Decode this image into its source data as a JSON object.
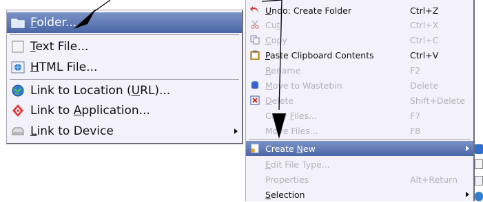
{
  "left_menu": {
    "items": [
      {
        "label_pre": "",
        "accel": "F",
        "label_post": "older..."
      },
      {
        "label_pre": "",
        "accel": "T",
        "label_post": "ext File..."
      },
      {
        "label_pre": "",
        "accel": "H",
        "label_post": "TML File..."
      },
      {
        "label_pre": "Link to Location (",
        "accel": "U",
        "label_post": "RL)..."
      },
      {
        "label_pre": "Link to ",
        "accel": "A",
        "label_post": "pplication..."
      },
      {
        "label_pre": "",
        "accel": "L",
        "label_post": "ink to Device"
      }
    ]
  },
  "right_menu": {
    "items": [
      {
        "label_pre": "",
        "accel": "U",
        "label_post": "ndo: Create Folder",
        "shortcut": "Ctrl+Z"
      },
      {
        "label_pre": "Cu",
        "accel": "t",
        "label_post": "",
        "shortcut": "Ctrl+X"
      },
      {
        "label_pre": "",
        "accel": "C",
        "label_post": "opy",
        "shortcut": "Ctrl+C"
      },
      {
        "label_pre": "",
        "accel": "P",
        "label_post": "aste Clipboard Contents",
        "shortcut": "Ctrl+V"
      },
      {
        "label_pre": "",
        "accel": "R",
        "label_post": "ename",
        "shortcut": "F2"
      },
      {
        "label_pre": "",
        "accel": "M",
        "label_post": "ove to Wastebin",
        "shortcut": "Delete"
      },
      {
        "label_pre": "",
        "accel": "D",
        "label_post": "elete",
        "shortcut": "Shift+Delete"
      },
      {
        "label_pre": "Copy ",
        "accel": "F",
        "label_post": "iles...",
        "shortcut": "F7"
      },
      {
        "label_pre": "Move Files...",
        "accel": "",
        "label_post": "",
        "shortcut": "F8"
      },
      {
        "label_pre": "Create ",
        "accel": "N",
        "label_post": "ew",
        "shortcut": ""
      },
      {
        "label_pre": "",
        "accel": "E",
        "label_post": "dit File Type...",
        "shortcut": ""
      },
      {
        "label_pre": "Properties",
        "accel": "",
        "label_post": "",
        "shortcut": "Alt+Return"
      },
      {
        "label_pre": "",
        "accel": "S",
        "label_post": "election",
        "shortcut": ""
      }
    ]
  },
  "colors": {
    "menu_bg": "#f3f1f9",
    "highlight": "#4a66a5",
    "disabled_text": "#b3b1bd"
  }
}
